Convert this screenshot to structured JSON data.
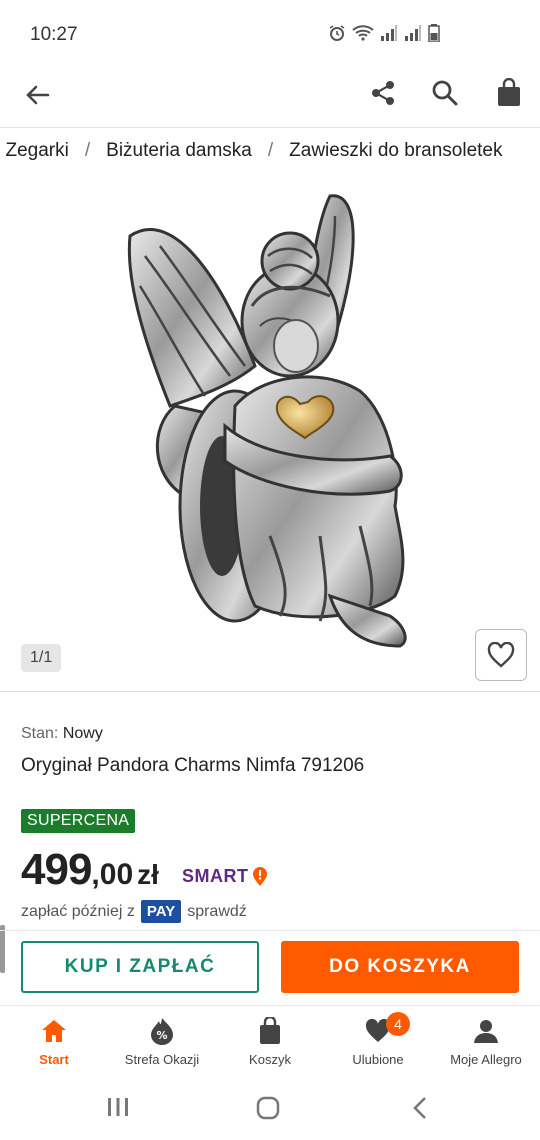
{
  "status": {
    "time": "10:27"
  },
  "breadcrumb": {
    "items": [
      "i Zegarki",
      "Biżuteria damska",
      "Zawieszki do bransoletek"
    ],
    "separator": "/"
  },
  "gallery": {
    "counter": "1/1",
    "image_subject": "silver fairy charm"
  },
  "product": {
    "condition_label": "Stan:",
    "condition_value": "Nowy",
    "title": "Oryginał Pandora Charms Nimfa 791206",
    "badge": "SUPERCENA",
    "price_int": "499",
    "price_dec": ",00",
    "currency": "zł",
    "smart_label": "SMART",
    "pay_later_prefix": "zapłać później z",
    "pay_logo": "PAY",
    "pay_later_link": "sprawdź"
  },
  "actions": {
    "buy_label": "KUP I ZAPŁAĆ",
    "cart_label": "DO KOSZYKA"
  },
  "nav": {
    "items": [
      {
        "label": "Start",
        "icon": "home-icon"
      },
      {
        "label": "Strefa Okazji",
        "icon": "deals-icon"
      },
      {
        "label": "Koszyk",
        "icon": "bag-icon"
      },
      {
        "label": "Ulubione",
        "icon": "heart-icon",
        "badge": "4"
      },
      {
        "label": "Moje Allegro",
        "icon": "user-icon"
      }
    ]
  },
  "colors": {
    "accent": "#ff5a00",
    "teal": "#148a73",
    "badge_green": "#1b7d2c",
    "smart_purple": "#5e2a84",
    "pay_blue": "#1c4fa1"
  }
}
